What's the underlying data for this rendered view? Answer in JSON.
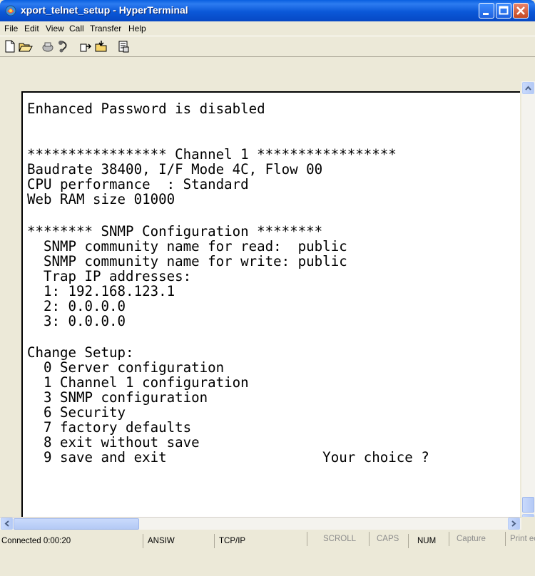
{
  "window": {
    "title": "xport_telnet_setup - HyperTerminal"
  },
  "menu": [
    {
      "label": "File"
    },
    {
      "label": "Edit"
    },
    {
      "label": "View"
    },
    {
      "label": "Call"
    },
    {
      "label": "Transfer"
    },
    {
      "label": "Help"
    }
  ],
  "toolbar": {
    "icons": [
      "new-icon",
      "open-icon",
      "disconnect-icon",
      "connect-icon",
      "send-icon",
      "receive-icon",
      "properties-icon"
    ]
  },
  "terminal": {
    "lines": [
      "Enhanced Password is disabled",
      "",
      "",
      "***************** Channel 1 *****************",
      "Baudrate 38400, I/F Mode 4C, Flow 00",
      "CPU performance  : Standard",
      "Web RAM size 01000",
      "",
      "******** SNMP Configuration ********",
      "  SNMP community name for read:  public",
      "  SNMP community name for write: public",
      "  Trap IP addresses:",
      "  1: 192.168.123.1",
      "  2: 0.0.0.0",
      "  3: 0.0.0.0",
      "",
      "Change Setup:",
      "  0 Server configuration",
      "  1 Channel 1 configuration",
      "  3 SNMP configuration",
      "  6 Security",
      "  7 factory defaults",
      "  8 exit without save",
      "  9 save and exit                   Your choice ?"
    ]
  },
  "statusbar": {
    "connected": "Connected 0:00:20",
    "emulation": "ANSIW",
    "protocol": "TCP/IP",
    "scroll": "SCROLL",
    "caps": "CAPS",
    "num": "NUM",
    "capture": "Capture",
    "print": "Print echo"
  },
  "colors": {
    "titlebar": "#0A5FE0",
    "chrome": "#ECE9D8",
    "terminal_bg": "#FFFFFF",
    "terminal_text": "#000000"
  }
}
